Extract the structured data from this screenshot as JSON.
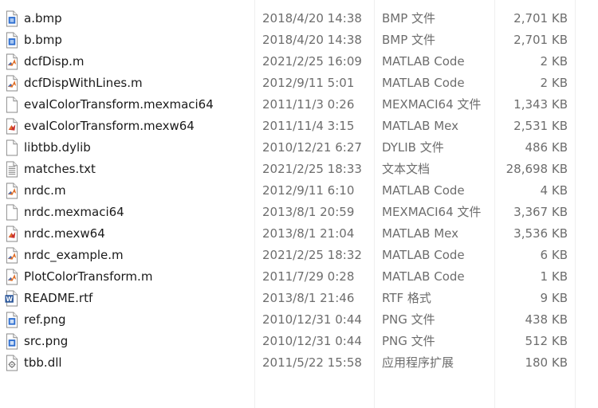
{
  "files": [
    {
      "name": "a.bmp",
      "date": "2018/4/20 14:38",
      "type": "BMP 文件",
      "size": "2,701 KB",
      "icon": "bmp-file-icon"
    },
    {
      "name": "b.bmp",
      "date": "2018/4/20 14:38",
      "type": "BMP 文件",
      "size": "2,701 KB",
      "icon": "bmp-file-icon"
    },
    {
      "name": "dcfDisp.m",
      "date": "2021/2/25 16:09",
      "type": "MATLAB Code",
      "size": "2 KB",
      "icon": "matlab-code-icon"
    },
    {
      "name": "dcfDispWithLines.m",
      "date": "2012/9/11 5:01",
      "type": "MATLAB Code",
      "size": "2 KB",
      "icon": "matlab-code-icon"
    },
    {
      "name": "evalColorTransform.mexmaci64",
      "date": "2011/11/3 0:26",
      "type": "MEXMACI64 文件",
      "size": "1,343 KB",
      "icon": "blank-file-icon"
    },
    {
      "name": "evalColorTransform.mexw64",
      "date": "2011/11/4 3:15",
      "type": "MATLAB Mex",
      "size": "2,531 KB",
      "icon": "matlab-mex-icon"
    },
    {
      "name": "libtbb.dylib",
      "date": "2010/12/21 6:27",
      "type": "DYLIB 文件",
      "size": "486 KB",
      "icon": "blank-file-icon"
    },
    {
      "name": "matches.txt",
      "date": "2021/2/25 18:33",
      "type": "文本文档",
      "size": "28,698 KB",
      "icon": "text-file-icon"
    },
    {
      "name": "nrdc.m",
      "date": "2012/9/11 6:10",
      "type": "MATLAB Code",
      "size": "4 KB",
      "icon": "matlab-code-icon"
    },
    {
      "name": "nrdc.mexmaci64",
      "date": "2013/8/1 20:59",
      "type": "MEXMACI64 文件",
      "size": "3,367 KB",
      "icon": "blank-file-icon"
    },
    {
      "name": "nrdc.mexw64",
      "date": "2013/8/1 21:04",
      "type": "MATLAB Mex",
      "size": "3,536 KB",
      "icon": "matlab-mex-icon"
    },
    {
      "name": "nrdc_example.m",
      "date": "2021/2/25 18:32",
      "type": "MATLAB Code",
      "size": "6 KB",
      "icon": "matlab-code-icon"
    },
    {
      "name": "PlotColorTransform.m",
      "date": "2011/7/29 0:28",
      "type": "MATLAB Code",
      "size": "1 KB",
      "icon": "matlab-code-icon"
    },
    {
      "name": "README.rtf",
      "date": "2013/8/1 21:46",
      "type": "RTF 格式",
      "size": "9 KB",
      "icon": "word-doc-icon"
    },
    {
      "name": "ref.png",
      "date": "2010/12/31 0:44",
      "type": "PNG 文件",
      "size": "438 KB",
      "icon": "png-file-icon"
    },
    {
      "name": "src.png",
      "date": "2010/12/31 0:44",
      "type": "PNG 文件",
      "size": "512 KB",
      "icon": "png-file-icon"
    },
    {
      "name": "tbb.dll",
      "date": "2011/5/22 15:58",
      "type": "应用程序扩展",
      "size": "180 KB",
      "icon": "dll-file-icon"
    }
  ],
  "colors": {
    "name_text": "#1a1a1a",
    "detail_text": "#6d6d6d",
    "image_icon_blue": "#2f6fd0",
    "matlab_orange": "#e0702a",
    "word_blue": "#2b579a"
  }
}
